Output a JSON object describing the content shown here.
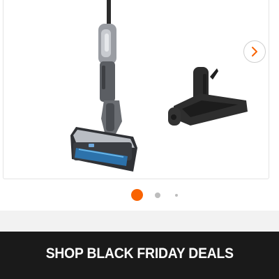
{
  "carousel": {
    "product_image_alt": "Cordless wet-dry floor vacuum with docking tray",
    "next_icon": "chevron-right-icon",
    "pagination": {
      "dot_count": 3,
      "active_index": 0
    }
  },
  "promo": {
    "label": "SHOP BLACK FRIDAY DEALS"
  },
  "colors": {
    "accent": "#f96302",
    "banner_bg": "#1a1a1a",
    "inactive_dot": "#bdbdbd",
    "band_bg": "#f2f2f2"
  }
}
